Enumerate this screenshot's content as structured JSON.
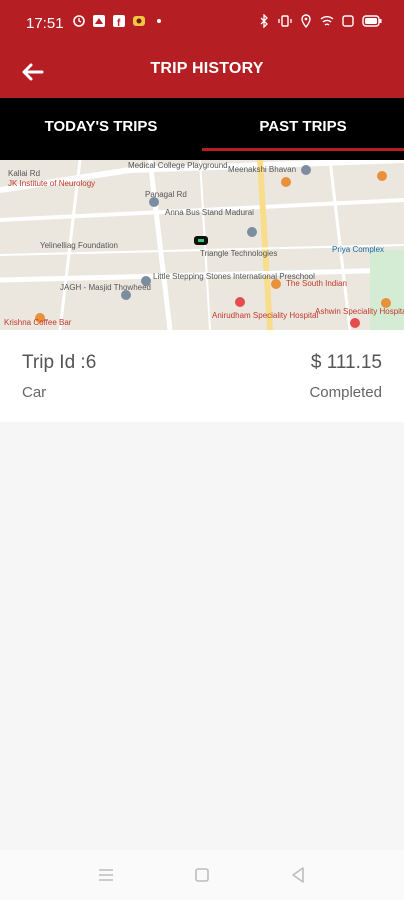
{
  "status_bar": {
    "time": "17:51"
  },
  "header": {
    "title": "TRIP HISTORY",
    "back_icon": "arrow-left-icon"
  },
  "tabs": [
    {
      "label": "TODAY'S TRIPS",
      "active": false
    },
    {
      "label": "PAST TRIPS",
      "active": true
    }
  ],
  "map": {
    "labels": [
      "Kallai Rd",
      "JK Institute of Neurology",
      "Panagal Rd",
      "Medical College Playground",
      "Meenakshi Bhavan",
      "Anna Bus Stand Madurai",
      "Yelinelliag Foundation",
      "Triangle Technologies",
      "Little Stepping Stones International Preschool",
      "JAGH - Masjid Thowheed",
      "Priya Complex",
      "The South Indian",
      "Anirudham Speciality Hospital",
      "Ashwin Speciality Hospital",
      "Krishna Coffee Bar"
    ]
  },
  "trip": {
    "id_label": "Trip Id :6",
    "vehicle": "Car",
    "price": "$ 111.15",
    "status": "Completed"
  },
  "colors": {
    "primary": "#b51f24",
    "tab_bg": "#000000"
  }
}
